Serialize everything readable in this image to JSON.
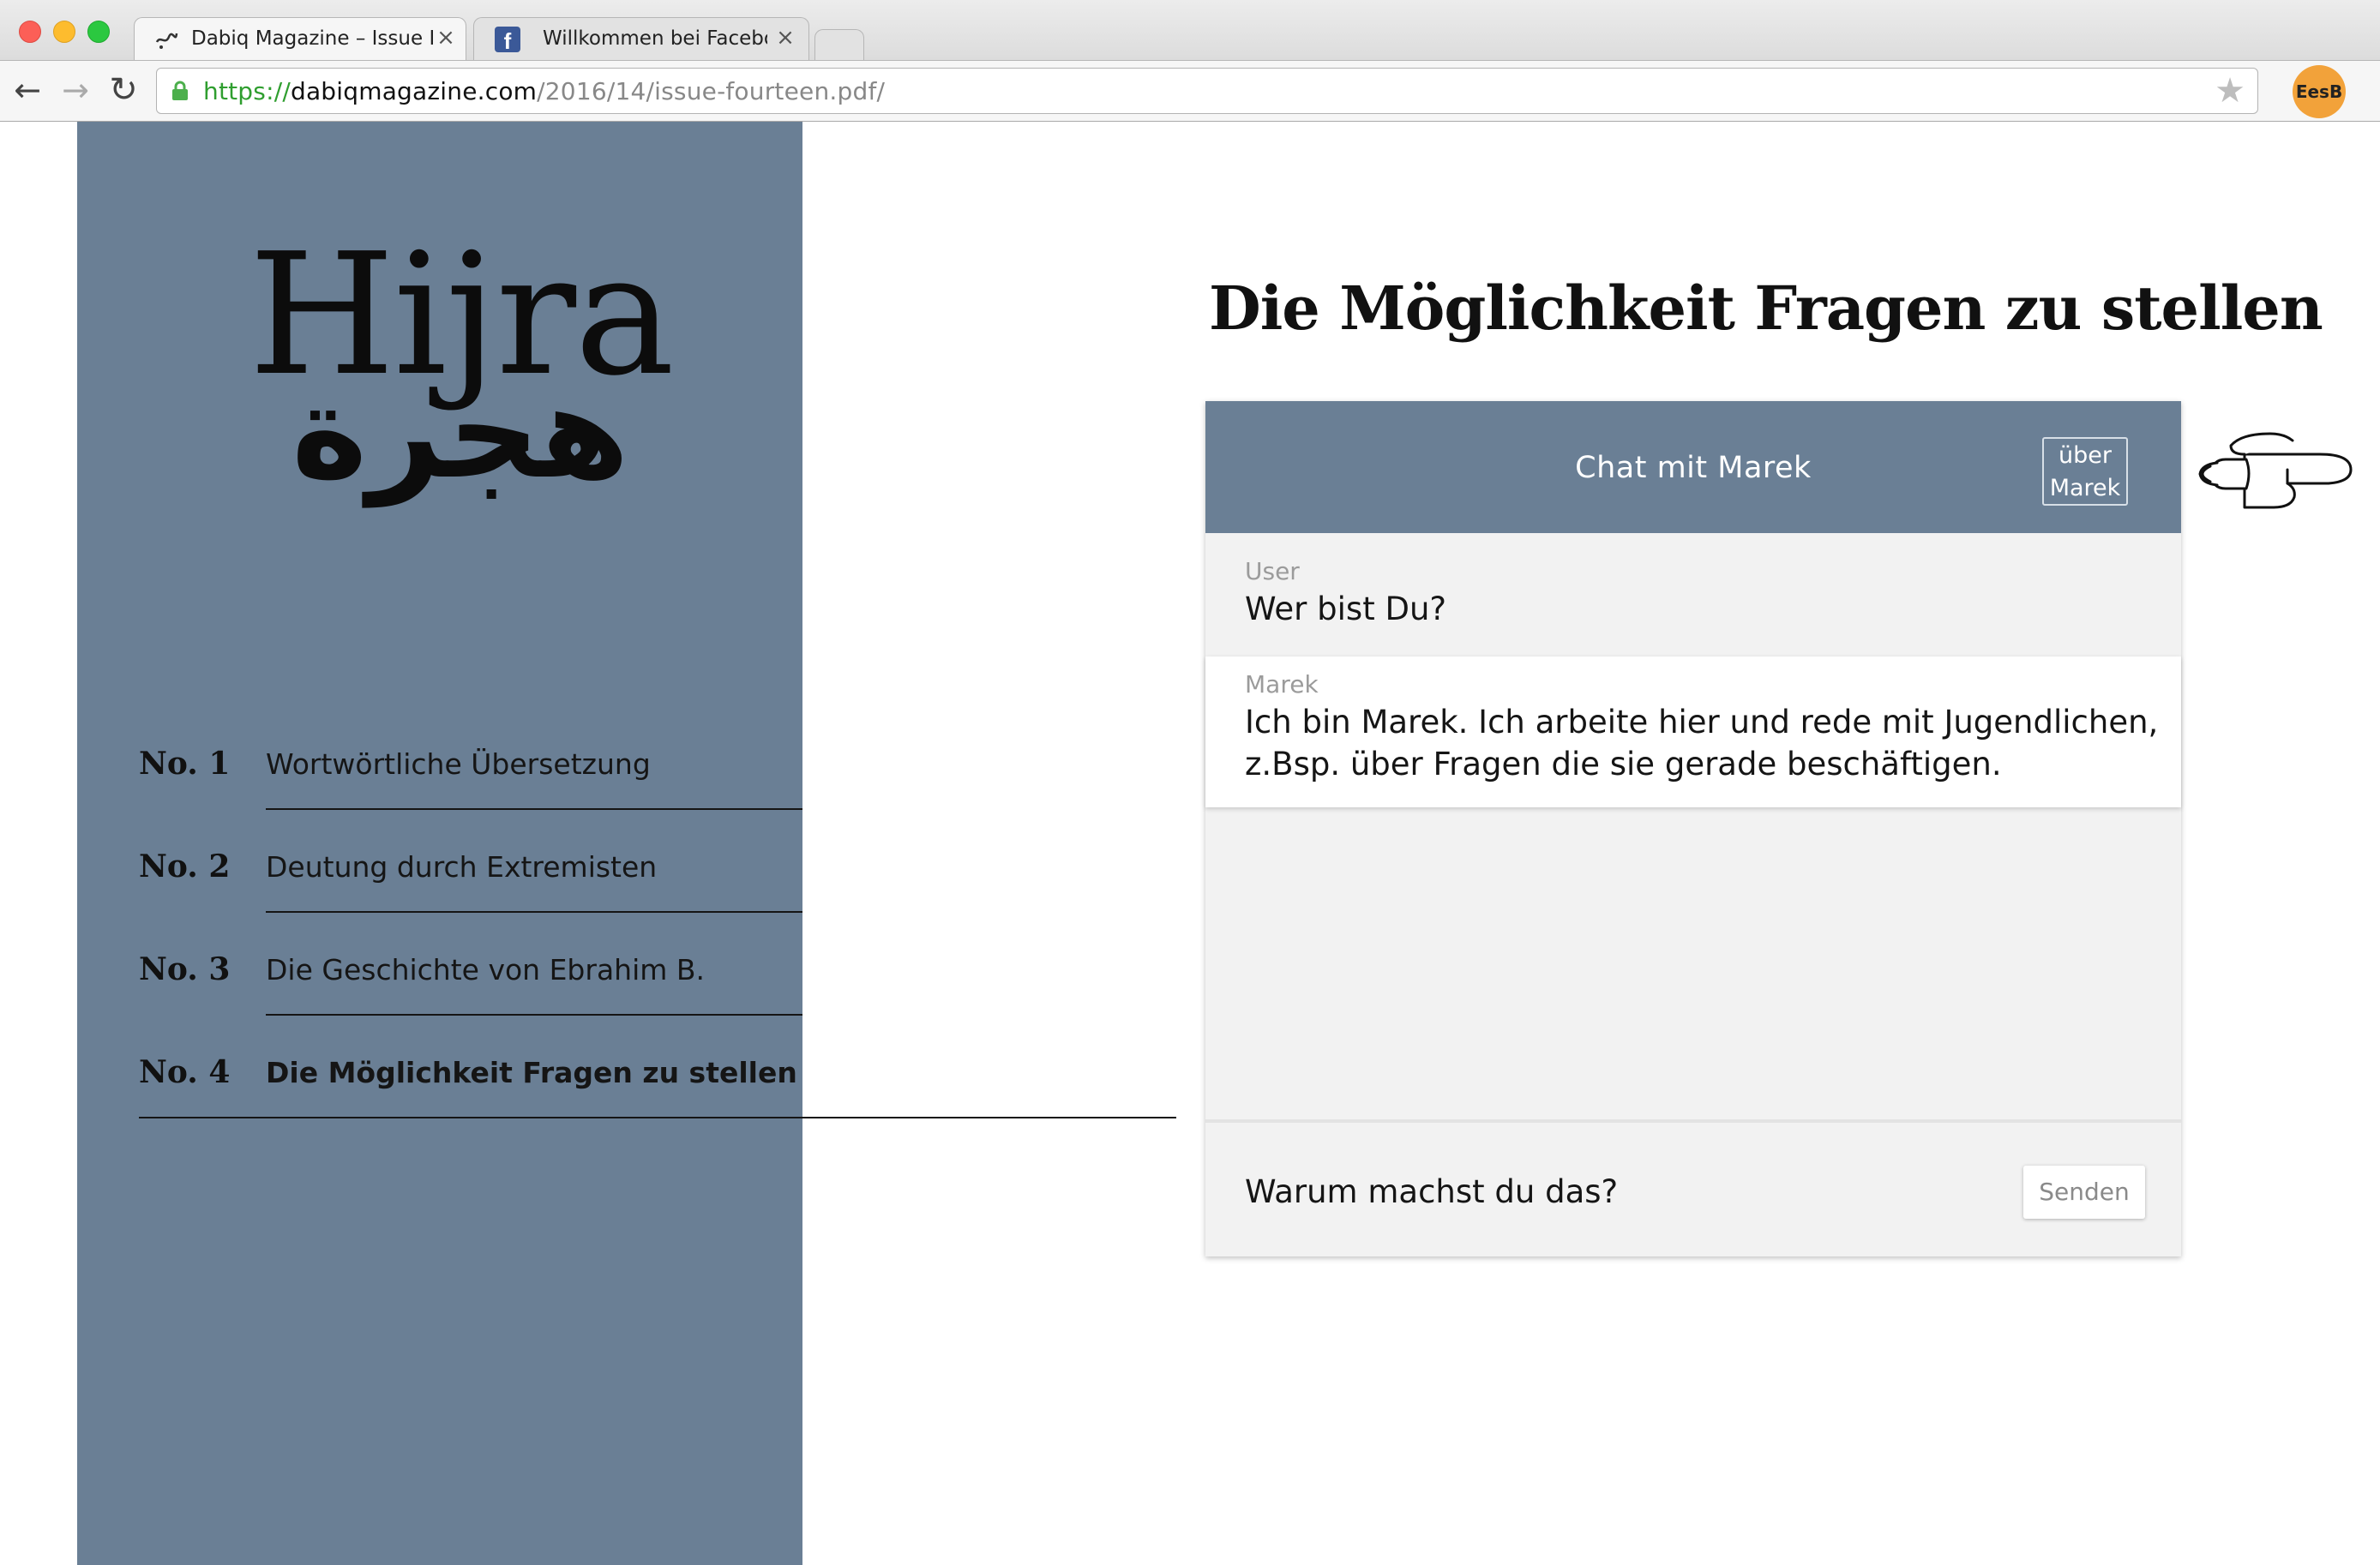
{
  "browser": {
    "tabs": [
      {
        "title": "Dabiq Magazine – Issue F",
        "favicon": "dabiq-calligraphy-icon",
        "active": true
      },
      {
        "title": "Willkommen bei Facebo",
        "favicon": "facebook-icon",
        "active": false
      }
    ],
    "address": {
      "scheme": "https://",
      "host": "dabiqmagazine.com",
      "path": "/2016/14/issue-fourteen.pdf/",
      "secure": true
    },
    "profile_label": "EesB"
  },
  "sidebar": {
    "logo_latin": "Hijra",
    "logo_arabic": "هجرة",
    "items": [
      {
        "number": "No. 1",
        "title": "Wortwörtliche Übersetzung",
        "active": false
      },
      {
        "number": "No. 2",
        "title": "Deutung durch Extremisten",
        "active": false
      },
      {
        "number": "No. 3",
        "title": "Die Geschichte von Ebrahim B.",
        "active": false
      },
      {
        "number": "No. 4",
        "title": "Die Möglichkeit Fragen zu stellen",
        "active": true
      }
    ]
  },
  "main": {
    "heading": "Die Möglichkeit Fragen zu stellen",
    "chat": {
      "title": "Chat mit Marek",
      "about_button": [
        "über",
        "Marek"
      ],
      "messages": [
        {
          "sender": "User",
          "text": "Wer bist Du?"
        },
        {
          "sender": "Marek",
          "lines": [
            "Ich bin Marek. Ich arbeite hier und rede mit Jugendlichen,",
            "z.Bsp. über Fragen die sie gerade beschäftigen."
          ]
        }
      ],
      "input_value": "Warum machst du das?",
      "send_label": "Senden"
    },
    "pointer_icon": "pointing-hand-icon"
  },
  "colors": {
    "panel": "#6a7f95",
    "chat_background": "#f2f2f2",
    "url_secure": "#2f9e2f",
    "profile": "#f2a23a"
  }
}
